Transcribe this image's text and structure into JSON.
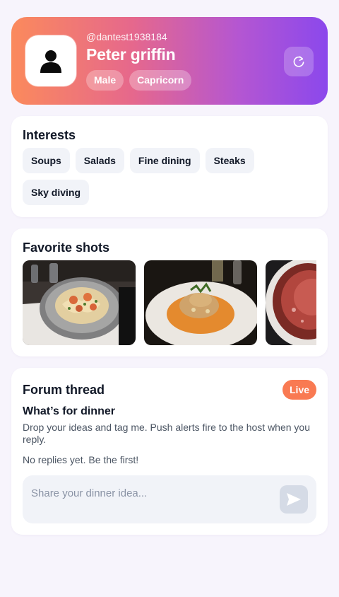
{
  "profile": {
    "handle": "@dantest1938184",
    "name": "Peter griffin",
    "tags": [
      "Male",
      "Capricorn"
    ],
    "avatar_icon": "user-icon",
    "refresh_icon": "refresh-icon"
  },
  "interests": {
    "title": "Interests",
    "items": [
      "Soups",
      "Salads",
      "Fine dining",
      "Steaks",
      "Sky diving"
    ]
  },
  "shots": {
    "title": "Favorite shots",
    "photos": [
      "shrimp-pasta-photo",
      "fish-risotto-photo",
      "steak-photo"
    ]
  },
  "forum": {
    "title": "Forum thread",
    "badge": "Live",
    "thread_title": "What’s for dinner",
    "description": "Drop your ideas and tag me. Push alerts fire to the host when you reply.",
    "empty_text": "No replies yet. Be the first!",
    "input_placeholder": "Share your dinner idea...",
    "input_value": "",
    "send_icon": "send-icon"
  },
  "colors": {
    "gradient_start": "#fb8a5c",
    "gradient_end": "#8b48ec",
    "live_badge": "#f97a52",
    "chip_bg": "#f1f3f8",
    "page_bg": "#f7f4fc"
  }
}
